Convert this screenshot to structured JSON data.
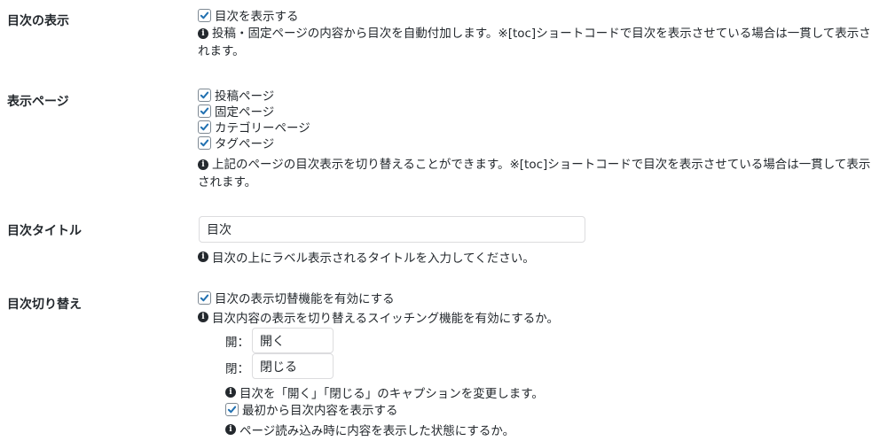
{
  "toc_display": {
    "label": "目次の表示",
    "checkbox_label": "目次を表示する",
    "checked": true,
    "desc_line1": "投稿・固定ページの内容から目次を自動付加します。※[toc]ショートコードで目次を表示させている場合は一貫して表示さ",
    "desc_line2": "れます。"
  },
  "display_pages": {
    "label": "表示ページ",
    "options": [
      {
        "label": "投稿ページ",
        "checked": true
      },
      {
        "label": "固定ページ",
        "checked": true
      },
      {
        "label": "カテゴリーページ",
        "checked": true
      },
      {
        "label": "タグページ",
        "checked": true
      }
    ],
    "desc_line1": "上記のページの目次表示を切り替えることができます。※[toc]ショートコードで目次を表示させている場合は一貫して表示",
    "desc_line2": "されます。"
  },
  "toc_title": {
    "label": "目次タイトル",
    "input_value": "目次",
    "desc": "目次の上にラベル表示されるタイトルを入力してください。"
  },
  "toc_toggle": {
    "label": "目次切り替え",
    "checkbox_label": "目次の表示切替機能を有効にする",
    "checked": true,
    "desc": "目次内容の表示を切り替えるスイッチング機能を有効にするか。",
    "open_label": "開：",
    "open_value": "開く",
    "close_label": "閉：",
    "close_value": "閉じる",
    "caption_desc": "目次を「開く」「閉じる」のキャプションを変更します。",
    "initial_open_label": "最初から目次内容を表示する",
    "initial_open_checked": true,
    "initial_open_desc": "ページ読み込み時に内容を表示した状態にするか。"
  },
  "icons": {
    "info": "info-circle-icon",
    "check": "checkmark-icon"
  },
  "colors": {
    "checkmark": "#2271b1",
    "text": "#23282d",
    "input_border": "#dcdcde"
  }
}
